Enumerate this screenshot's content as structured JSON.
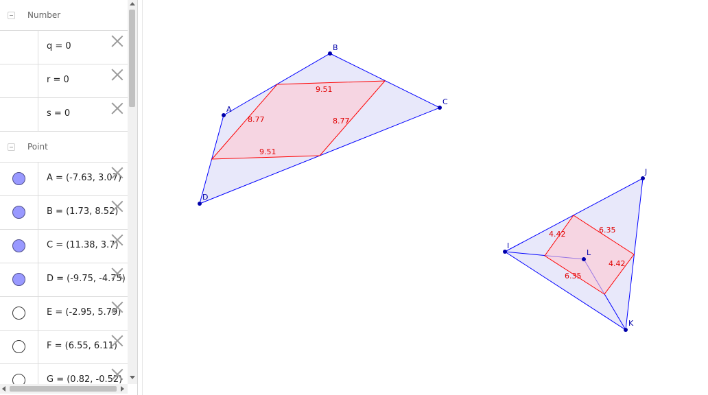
{
  "algebra_view": {
    "groups": [
      {
        "title": "Number",
        "items": [
          {
            "expr": "q = 0",
            "marble": "none"
          },
          {
            "expr": "r = 0",
            "marble": "none"
          },
          {
            "expr": "s = 0",
            "marble": "none"
          }
        ]
      },
      {
        "title": "Point",
        "items": [
          {
            "expr": "A = (-7.63, 3.07)",
            "marble": "filled"
          },
          {
            "expr": "B = (1.73, 8.52)",
            "marble": "filled"
          },
          {
            "expr": "C = (11.38, 3.7)",
            "marble": "filled"
          },
          {
            "expr": "D = (-9.75, -4.75)",
            "marble": "filled"
          },
          {
            "expr": "E = (-2.95, 5.79)",
            "marble": "empty"
          },
          {
            "expr": "F = (6.55, 6.11)",
            "marble": "empty"
          },
          {
            "expr": "G = (0.82, -0.52)",
            "marble": "empty"
          }
        ]
      }
    ]
  },
  "graphics": {
    "colors": {
      "point": "#0000aa",
      "polygon_fill": "#e6e6fa",
      "polygon_stroke": "#0000ff",
      "inner_stroke": "#ff0000",
      "inner_fill": "#ffc8d2"
    },
    "points": {
      "A": "A",
      "B": "B",
      "C": "C",
      "D": "D",
      "I": "I",
      "J": "J",
      "K": "K",
      "L": "L"
    },
    "segment_labels": {
      "top1": "9.51",
      "left1": "8.77",
      "right1": "8.77",
      "bottom1": "9.51",
      "q2_a": "4.42",
      "q2_b": "6.35",
      "q2_c": "4.42",
      "q2_d": "6.35"
    }
  }
}
